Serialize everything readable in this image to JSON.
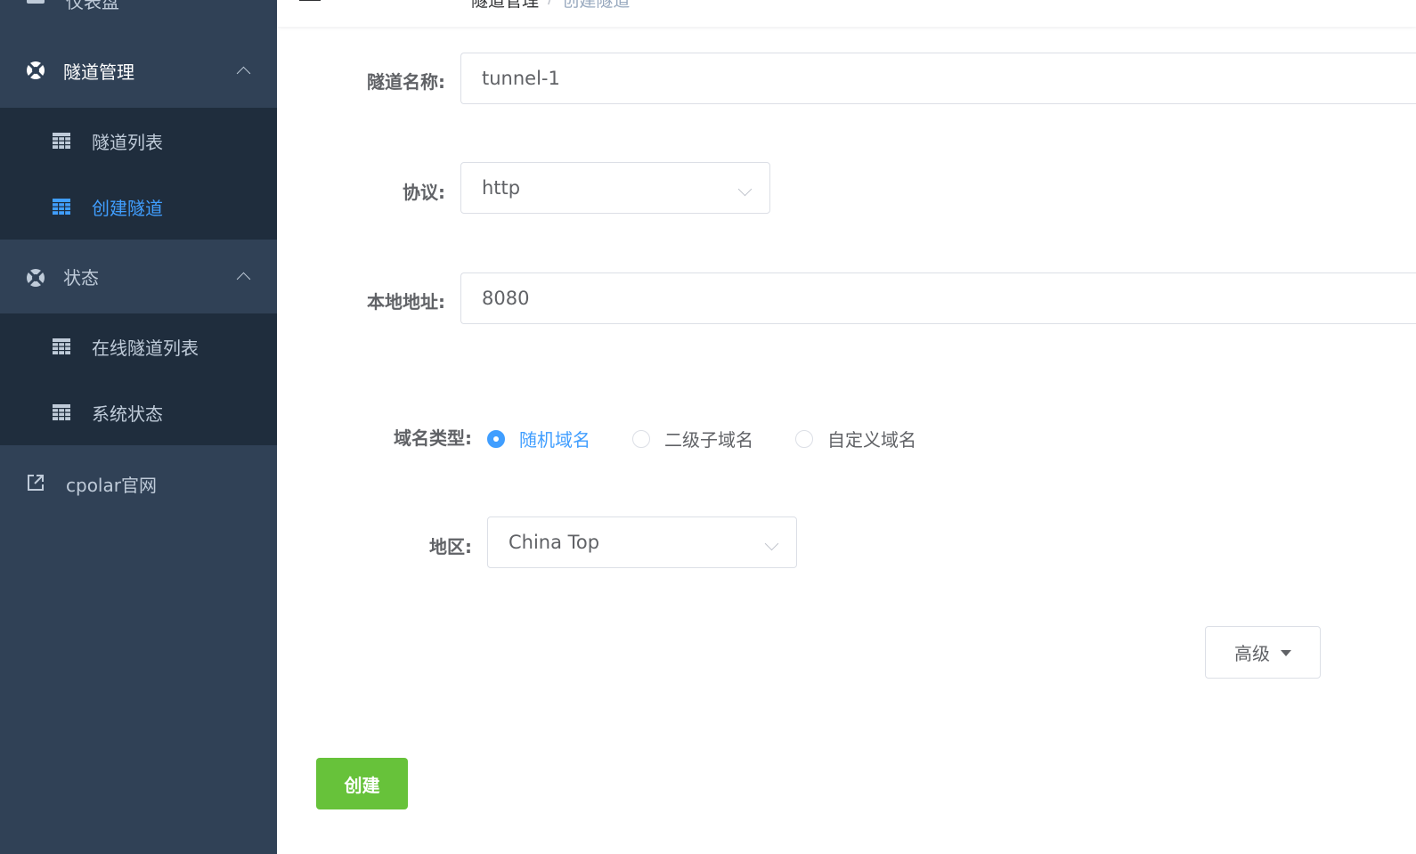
{
  "sidebar": {
    "top_item": "仪表盘",
    "groups": [
      {
        "label": "隧道管理",
        "children": [
          "隧道列表",
          "创建隧道"
        ]
      },
      {
        "label": "状态",
        "children": [
          "在线隧道列表",
          "系统状态"
        ]
      }
    ],
    "active_item": "创建隧道",
    "external_link": "cpolar官网"
  },
  "header": {
    "breadcrumb": [
      "隧道管理",
      "创建隧道"
    ]
  },
  "form": {
    "tunnel_name": {
      "label": "隧道名称:",
      "value": "tunnel-1"
    },
    "protocol": {
      "label": "协议:",
      "value": "http"
    },
    "local_address": {
      "label": "本地地址:",
      "value": "8080"
    },
    "domain_type": {
      "label": "域名类型:",
      "options": [
        "随机域名",
        "二级子域名",
        "自定义域名"
      ],
      "selected": "随机域名"
    },
    "region": {
      "label": "地区:",
      "value": "China Top"
    },
    "advanced_label": "高级",
    "create_label": "创建"
  },
  "colors": {
    "sidebar_bg": "#304156",
    "submenu_bg": "#1f2d3d",
    "active": "#409eff",
    "create_button": "#67c23a"
  }
}
